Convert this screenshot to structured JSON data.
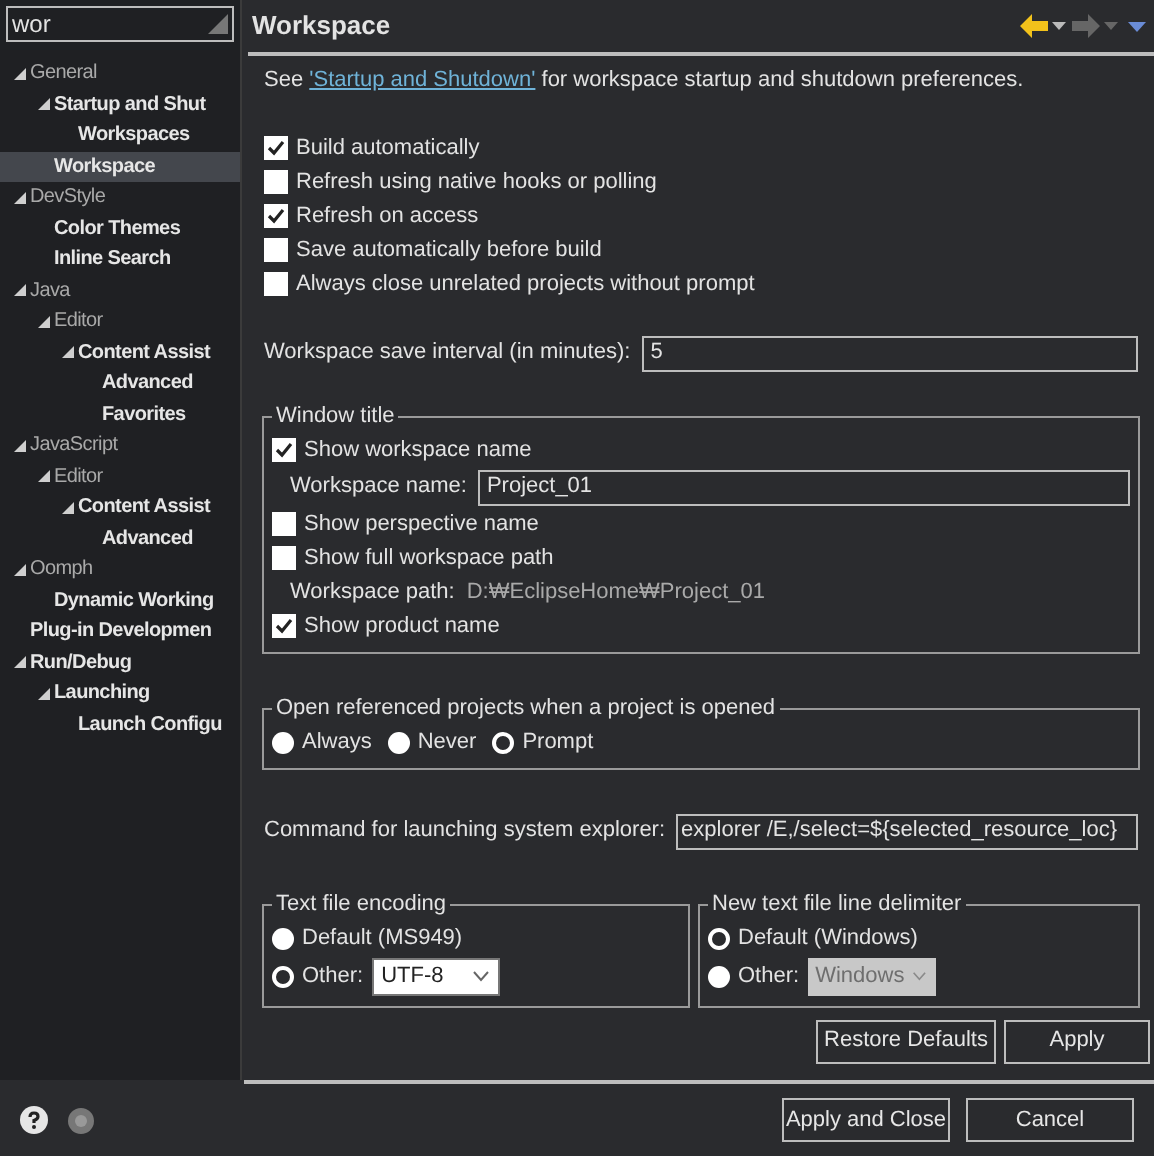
{
  "filter": {
    "value": "wor"
  },
  "tree": [
    {
      "label": "General",
      "match": false,
      "expanded": true,
      "children": [
        {
          "label": "Startup and Shut",
          "match": true,
          "expanded": true,
          "children": [
            {
              "label": "Workspaces",
              "match": true,
              "selected": false
            }
          ]
        },
        {
          "label": "Workspace",
          "match": true,
          "selected": true
        }
      ]
    },
    {
      "label": "DevStyle",
      "match": false,
      "expanded": true,
      "children": [
        {
          "label": "Color Themes",
          "match": true,
          "selected": false
        },
        {
          "label": "Inline Search",
          "match": true,
          "selected": false
        }
      ]
    },
    {
      "label": "Java",
      "match": false,
      "expanded": true,
      "children": [
        {
          "label": "Editor",
          "match": false,
          "expanded": true,
          "children": [
            {
              "label": "Content Assist",
              "match": true,
              "expanded": true,
              "children": [
                {
                  "label": "Advanced",
                  "match": true,
                  "selected": false
                },
                {
                  "label": "Favorites",
                  "match": true,
                  "selected": false
                }
              ]
            }
          ]
        }
      ]
    },
    {
      "label": "JavaScript",
      "match": false,
      "expanded": true,
      "children": [
        {
          "label": "Editor",
          "match": false,
          "expanded": true,
          "children": [
            {
              "label": "Content Assist",
              "match": true,
              "expanded": true,
              "children": [
                {
                  "label": "Advanced",
                  "match": true,
                  "selected": false
                }
              ]
            }
          ]
        }
      ]
    },
    {
      "label": "Oomph",
      "match": false,
      "expanded": true,
      "children": [
        {
          "label": "Dynamic Working",
          "match": true,
          "selected": false
        }
      ]
    },
    {
      "label": "Plug-in Developmen",
      "match": true,
      "selected": false
    },
    {
      "label": "Run/Debug",
      "match": true,
      "expanded": true,
      "children": [
        {
          "label": "Launching",
          "match": true,
          "expanded": true,
          "children": [
            {
              "label": "Launch Configu",
              "match": true,
              "selected": false
            }
          ]
        }
      ]
    }
  ],
  "page": {
    "title": "Workspace",
    "intro": {
      "before": "See ",
      "link": "'Startup and Shutdown'",
      "after": " for workspace startup and shutdown preferences."
    },
    "options": [
      {
        "label": "Build automatically",
        "checked": true
      },
      {
        "label": "Refresh using native hooks or polling",
        "checked": false
      },
      {
        "label": "Refresh on access",
        "checked": true
      },
      {
        "label": "Save automatically before build",
        "checked": false
      },
      {
        "label": "Always close unrelated projects without prompt",
        "checked": false
      }
    ],
    "save_interval": {
      "label": "Workspace save interval (in minutes):",
      "value": "5"
    },
    "window_title": {
      "legend": "Window title",
      "show_workspace_name": {
        "label": "Show workspace name",
        "checked": true
      },
      "workspace_name": {
        "label": "Workspace name:",
        "value": "Project_01"
      },
      "show_perspective_name": {
        "label": "Show perspective name",
        "checked": false
      },
      "show_full_path": {
        "label": "Show full workspace path",
        "checked": false
      },
      "workspace_path": {
        "label": "Workspace path:",
        "value": "D:₩EclipseHome₩Project_01"
      },
      "show_product_name": {
        "label": "Show product name",
        "checked": true
      }
    },
    "open_referenced": {
      "legend": "Open referenced projects when a project is opened",
      "options": [
        {
          "label": "Always",
          "selected": false
        },
        {
          "label": "Never",
          "selected": false
        },
        {
          "label": "Prompt",
          "selected": true
        }
      ]
    },
    "explorer_command": {
      "label": "Command for launching system explorer:",
      "value": "explorer /E,/select=${selected_resource_loc}"
    },
    "encoding": {
      "legend": "Text file encoding",
      "default": {
        "label": "Default (MS949)",
        "selected": false
      },
      "other": {
        "label": "Other:",
        "selected": true
      },
      "combo": {
        "value": "UTF-8",
        "disabled": false
      }
    },
    "delimiter": {
      "legend": "New text file line delimiter",
      "default": {
        "label": "Default (Windows)",
        "selected": true
      },
      "other": {
        "label": "Other:",
        "selected": false
      },
      "combo": {
        "value": "Windows",
        "disabled": true
      }
    },
    "restore_button": "Restore Defaults",
    "apply_button": "Apply"
  },
  "footer": {
    "apply_close_button": "Apply and Close",
    "cancel_button": "Cancel"
  }
}
